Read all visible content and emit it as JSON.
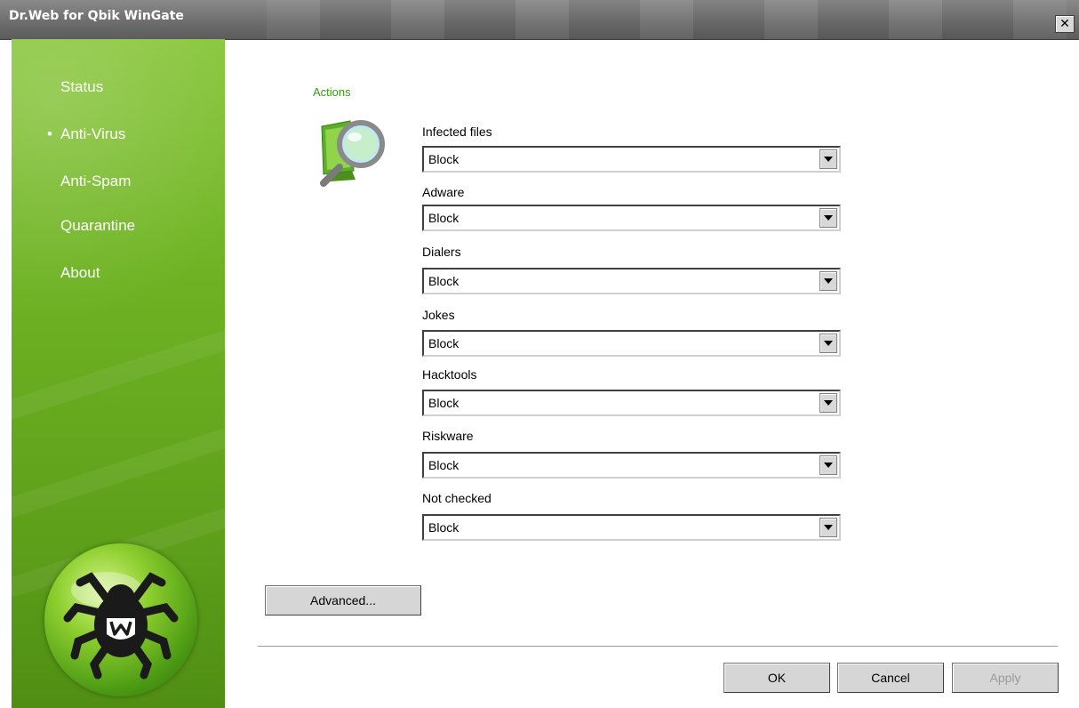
{
  "window": {
    "title": "Dr.Web for Qbik WinGate",
    "close_glyph": "✕"
  },
  "sidebar": {
    "items": [
      {
        "label": "Status",
        "active": false
      },
      {
        "label": "Anti-Virus",
        "active": true
      },
      {
        "label": "Anti-Spam",
        "active": false
      },
      {
        "label": "Quarantine",
        "active": false
      },
      {
        "label": "About",
        "active": false
      }
    ],
    "active_marker": "•",
    "logo_icon": "drweb-spider-logo-icon"
  },
  "main": {
    "section_title": "Actions",
    "section_icon": "scan-magnifier-icon",
    "fields": [
      {
        "label": "Infected files",
        "value": "Block"
      },
      {
        "label": "Adware",
        "value": "Block"
      },
      {
        "label": "Dialers",
        "value": "Block"
      },
      {
        "label": "Jokes",
        "value": "Block"
      },
      {
        "label": "Hacktools",
        "value": "Block"
      },
      {
        "label": "Riskware",
        "value": "Block"
      },
      {
        "label": "Not checked",
        "value": "Block"
      }
    ],
    "advanced_label": "Advanced..."
  },
  "footer": {
    "ok_label": "OK",
    "cancel_label": "Cancel",
    "apply_label": "Apply",
    "apply_enabled": false
  },
  "colors": {
    "sidebar_green": "#6fb324",
    "title_gray": "#6e6e6e",
    "section_title": "#3a9a14"
  }
}
